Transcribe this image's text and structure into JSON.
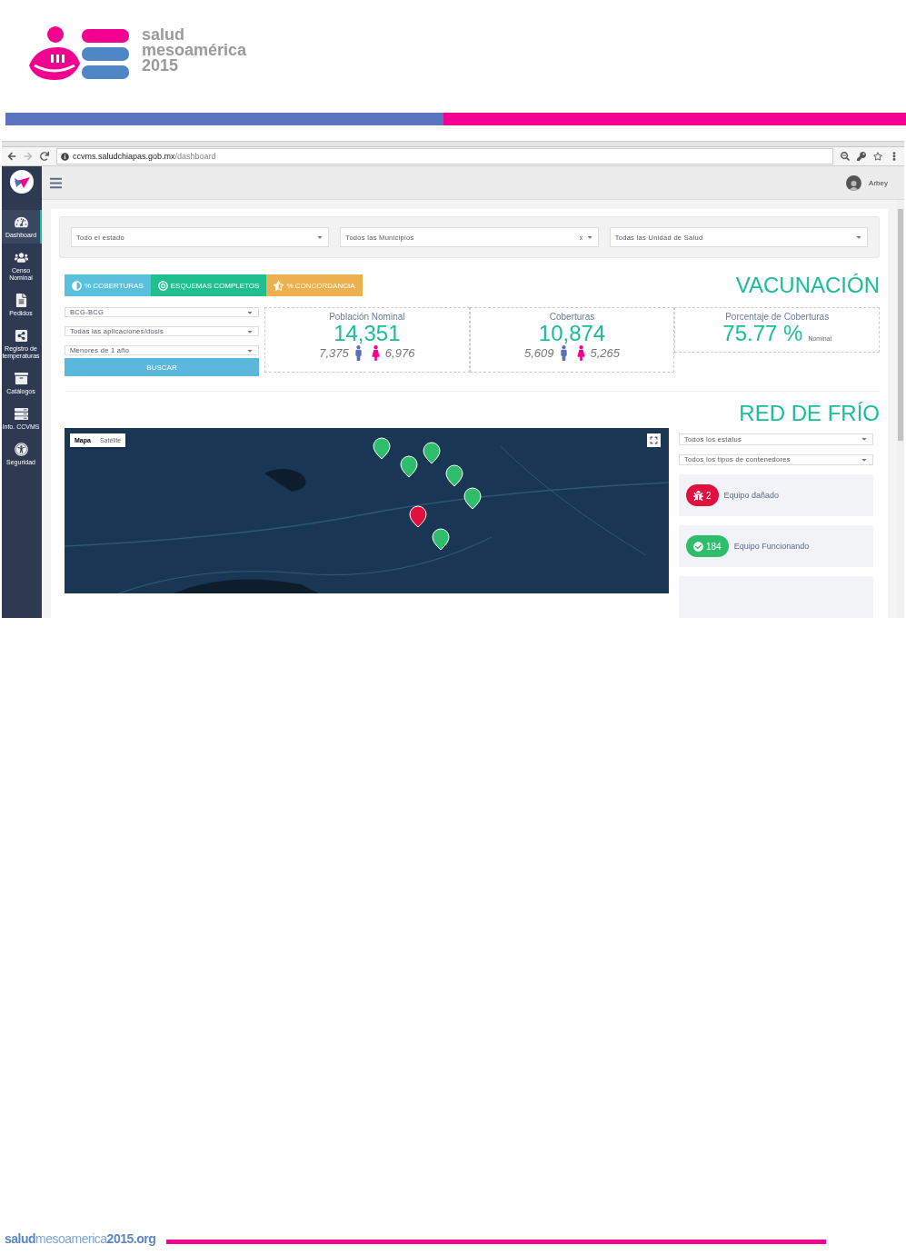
{
  "document": {
    "logo": {
      "lines": [
        "salud",
        "mesoamérica",
        "**20**15"
      ]
    },
    "footer": {
      "site": "**salud**mesoamerica**2015.org**"
    }
  },
  "browser": {
    "url_host": "ccvms.saludchiapas.gob.mx",
    "url_path": "/dashboard"
  },
  "sidebar": {
    "items": [
      {
        "label": "Dashboard",
        "selected": true
      },
      {
        "label": "Censo Nominal",
        "selected": false
      },
      {
        "label": "Pedidos",
        "selected": false
      },
      {
        "label": "Registro de temperaturas",
        "selected": false
      },
      {
        "label": "Catálogos",
        "selected": false
      },
      {
        "label": "Info. CCVMS",
        "selected": false
      },
      {
        "label": "Seguridad",
        "selected": false
      }
    ]
  },
  "topbar": {
    "user": "Arbey"
  },
  "filters": [
    {
      "value": "Todo el estado"
    },
    {
      "value": "Todos las Municipios",
      "clear": "x"
    },
    {
      "value": "Todas las Unidad de Salud"
    }
  ],
  "vacunacion": {
    "title": "VACUNACIÓN",
    "tabs": [
      {
        "label": "% COBERTURAS",
        "color": "#5bc0de"
      },
      {
        "label": "ESQUEMAS COMPLETOS",
        "color": "#1fbf8f"
      },
      {
        "label": "% CONCORDANCIA",
        "color": "#ecb14e"
      }
    ],
    "selects": [
      "BCG-BCG",
      "Todas las aplicaciones/dosis",
      "Menores de 1 año"
    ],
    "button": "BUSCAR",
    "stats": [
      {
        "title": "Población Nominal",
        "value": "14,351",
        "male": "7,375",
        "female": "6,976"
      },
      {
        "title": "Coberturas",
        "value": "10,874",
        "male": "5,609",
        "female": "5,265"
      },
      {
        "title": "Porcentaje de Coberturas",
        "value": "75.77 %",
        "note": "Nominal"
      }
    ]
  },
  "red_de_frio": {
    "title": "RED DE FRÍO",
    "map": {
      "kind": "picture",
      "map_types": [
        {
          "label": "Mapa",
          "selected": true
        },
        {
          "label": "Satélite",
          "selected": false
        }
      ]
    },
    "selects": [
      "Todos los estatus",
      "Todos los tipos de contenedores"
    ],
    "status": [
      {
        "count": "2",
        "label": "Equipo dañado",
        "color": "#e0103f"
      },
      {
        "count": "184",
        "label": "Equipo Funcionando",
        "color": "#2ebd6b"
      }
    ]
  }
}
